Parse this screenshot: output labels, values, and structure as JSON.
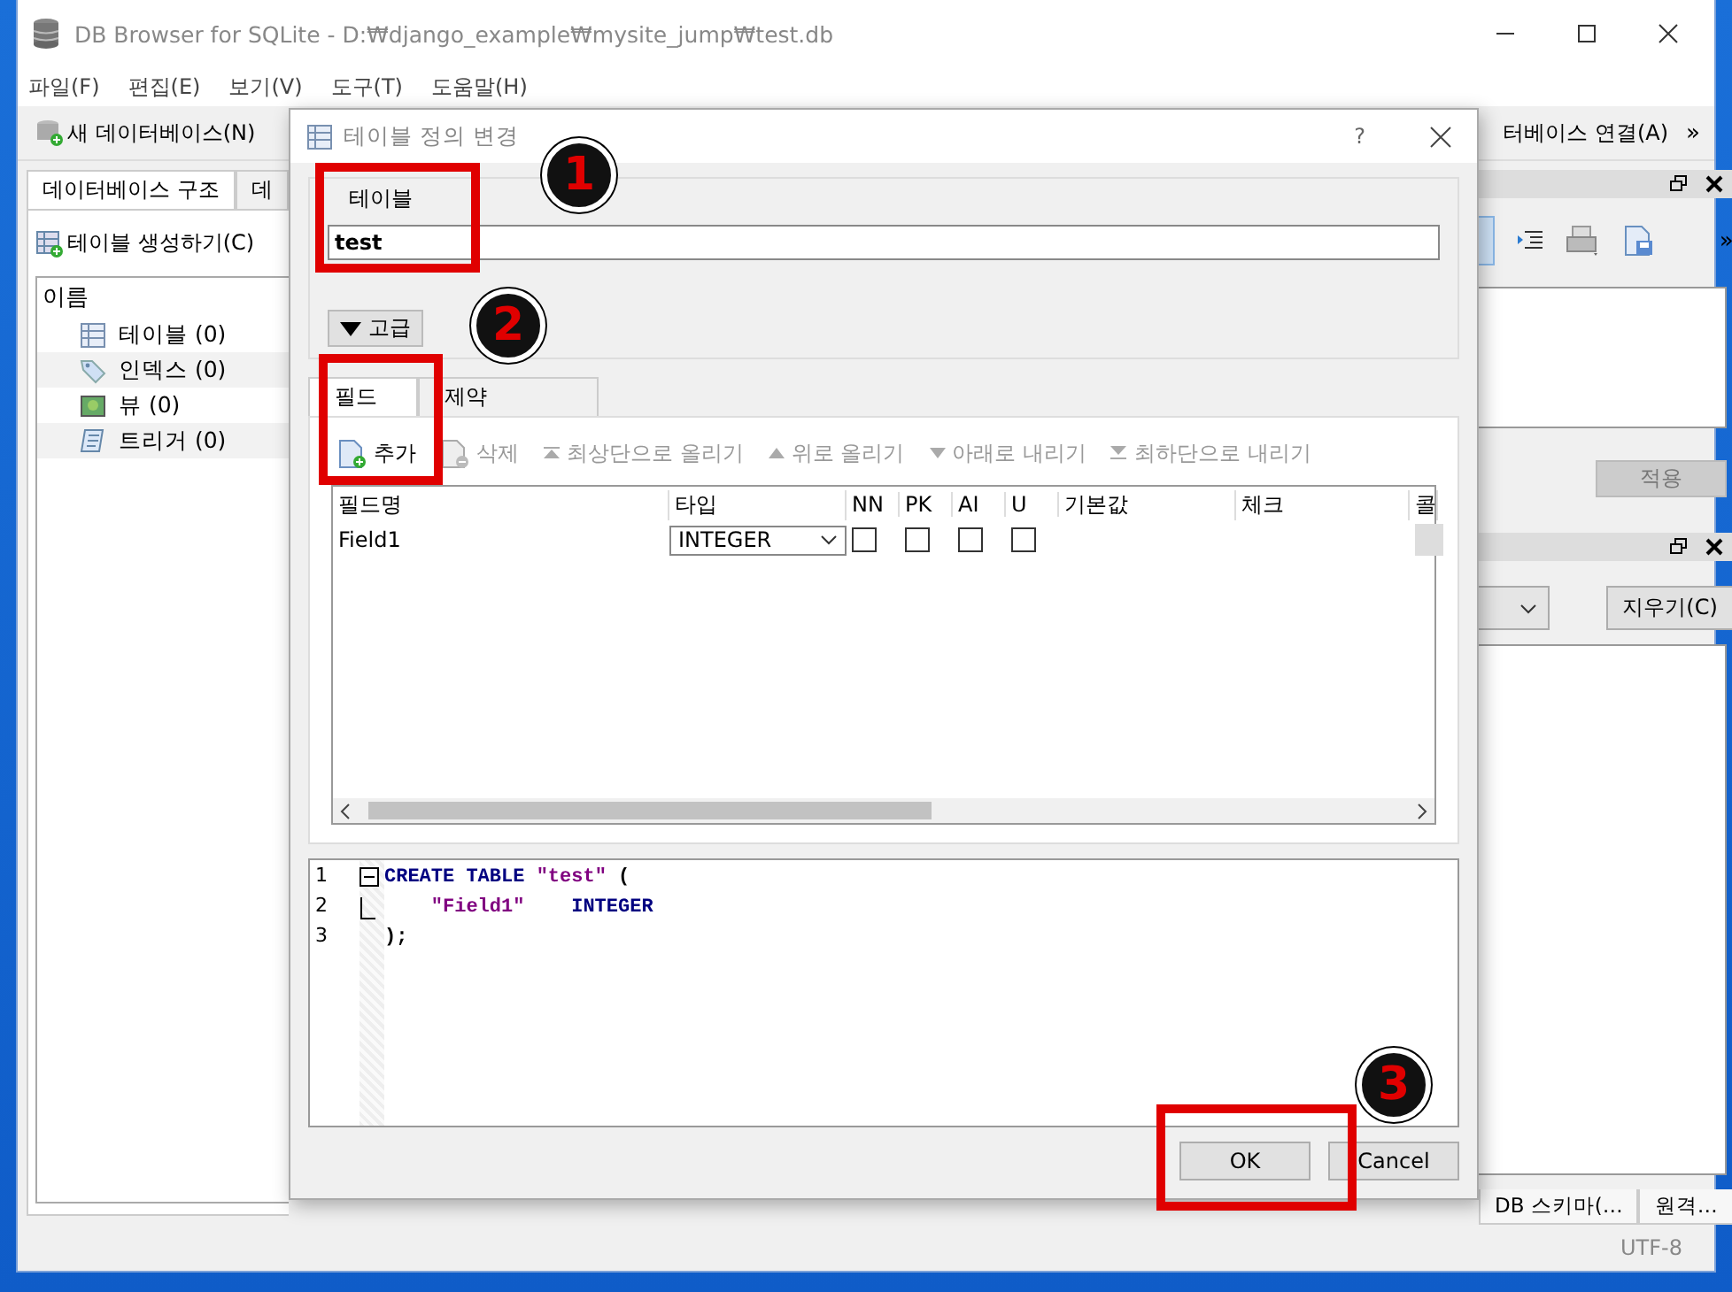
{
  "main_window": {
    "title": "DB Browser for SQLite - D:₩django_example₩mysite_jump₩test.db"
  },
  "menu": [
    "파일(F)",
    "편집(E)",
    "보기(V)",
    "도구(T)",
    "도움말(H)"
  ],
  "toolbar": {
    "new_db": "새 데이터베이스(N)",
    "connect_db": "터베이스 연결(A)",
    "overflow": "»"
  },
  "left_tabs": [
    {
      "label": "데이터베이스 구조",
      "selected": true
    },
    {
      "label": "데",
      "selected": false
    }
  ],
  "create_table_button": "테이블 생성하기(C)",
  "tree": {
    "header": "이름",
    "items": [
      {
        "label": "테이블 (0)",
        "kind": "table"
      },
      {
        "label": "인덱스 (0)",
        "kind": "index"
      },
      {
        "label": "뷰 (0)",
        "kind": "view"
      },
      {
        "label": "트리거 (0)",
        "kind": "trigger"
      }
    ]
  },
  "right_panel": {
    "overflow": "»",
    "apply_button": "적용",
    "clear_button": "지우기(C)",
    "bottom_tabs": [
      "DB 스키마(…",
      "원격…"
    ]
  },
  "status_bar": {
    "encoding": "UTF-8"
  },
  "dialog": {
    "title": "테이블 정의 변경",
    "help": "?",
    "table_group": "테이블",
    "table_name": "test",
    "advanced_button": "고급",
    "tabs": [
      {
        "label": "필드",
        "selected": true
      },
      {
        "label": "제약",
        "selected": false
      }
    ],
    "toolbar": [
      {
        "label": "추가",
        "kind": "add",
        "disabled": false
      },
      {
        "label": "삭제",
        "kind": "remove",
        "disabled": true
      },
      {
        "label": "최상단으로 올리기",
        "kind": "top",
        "disabled": true
      },
      {
        "label": "위로 올리기",
        "kind": "up",
        "disabled": true
      },
      {
        "label": "아래로 내리기",
        "kind": "down",
        "disabled": true
      },
      {
        "label": "최하단으로 내리기",
        "kind": "bottom",
        "disabled": true
      }
    ],
    "columns": [
      "필드명",
      "타입",
      "NN",
      "PK",
      "AI",
      "U",
      "기본값",
      "체크",
      "콜"
    ],
    "rows": [
      {
        "name": "Field1",
        "type": "INTEGER",
        "nn": false,
        "pk": false,
        "ai": false,
        "u": false
      }
    ],
    "sql": [
      {
        "number": "1",
        "kind": "fold-start",
        "indent": false,
        "tokens": [
          {
            "text": "CREATE TABLE",
            "kind": "keyword"
          },
          {
            "text": "\"test\"",
            "kind": "string"
          },
          {
            "text": "(",
            "kind": "plain"
          }
        ]
      },
      {
        "number": "2",
        "kind": "fold-end",
        "indent": true,
        "tokens": [
          {
            "text": "\"Field1\"",
            "kind": "string"
          },
          {
            "text": "INTEGER",
            "kind": "keyword"
          }
        ]
      },
      {
        "number": "3",
        "kind": "plain",
        "indent": false,
        "tokens": [
          {
            "text": ");",
            "kind": "plain"
          }
        ]
      }
    ],
    "buttons": [
      "OK",
      "Cancel"
    ]
  },
  "annotations": [
    {
      "number": "1"
    },
    {
      "number": "2"
    },
    {
      "number": "3"
    }
  ]
}
